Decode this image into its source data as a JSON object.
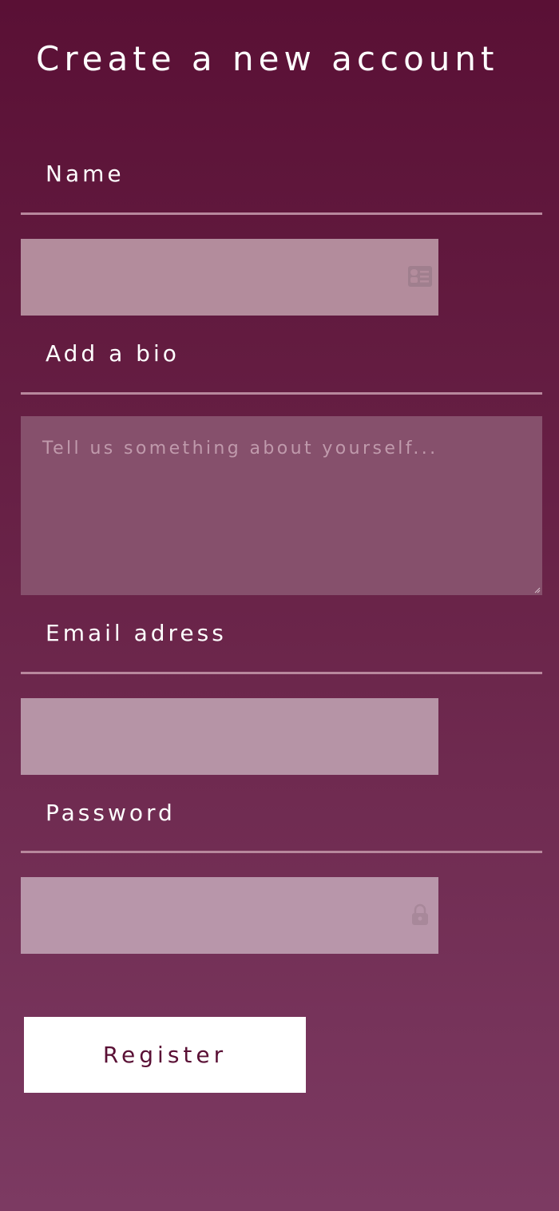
{
  "title": "Create a new account",
  "form": {
    "name": {
      "label": "Name",
      "value": ""
    },
    "bio": {
      "label": "Add a bio",
      "placeholder": "Tell us something about yourself...",
      "value": ""
    },
    "email": {
      "label": "Email adress",
      "value": ""
    },
    "password": {
      "label": "Password",
      "value": ""
    },
    "register_label": "Register"
  },
  "icons": {
    "name_field": "id-card-icon",
    "password_field": "lock-icon",
    "bio_field": "resize-handle-icon"
  },
  "colors": {
    "background_top": "#5a1035",
    "background_bottom": "#7c3a62",
    "input_background": "#b38c9c",
    "textarea_background": "#86506c",
    "button_background": "#ffffff",
    "button_text": "#5a1035"
  }
}
